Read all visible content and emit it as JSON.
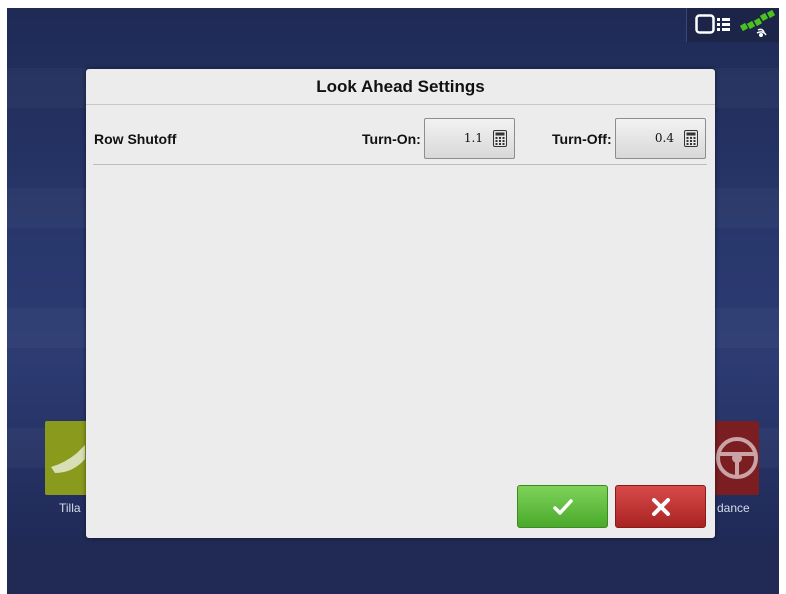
{
  "dialog": {
    "title": "Look Ahead Settings",
    "row_label": "Row Shutoff",
    "turn_on": {
      "label": "Turn-On:",
      "value": "1.1"
    },
    "turn_off": {
      "label": "Turn-Off:",
      "value": "0.4"
    }
  },
  "buttons": {
    "ok_icon": "check-icon",
    "cancel_icon": "x-icon"
  },
  "background_tiles": {
    "left": {
      "label": "Tilla",
      "color": "#8a9a1c"
    },
    "right": {
      "label": "dance",
      "color": "#7a1e22"
    }
  },
  "status_icons": [
    "display-icon",
    "gps-icon"
  ],
  "colors": {
    "ok": "#4aa92b",
    "cancel": "#a92323",
    "background": "#28376c",
    "dialog": "#ececec"
  }
}
